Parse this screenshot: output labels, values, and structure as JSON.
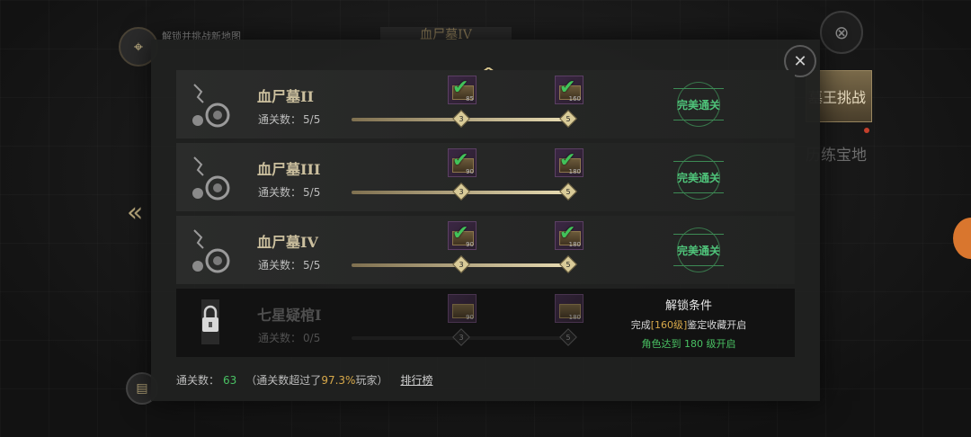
{
  "background": {
    "map_hint": "解锁并挑战新地图",
    "title_tab": "血尸墓IV",
    "challenge_label": "墓王挑战",
    "sub_label": "历练宝地"
  },
  "rows": [
    {
      "name": "血尸墓II",
      "clear_label": "通关数：",
      "clear_value": "5/5",
      "progress": 1.0,
      "nodes": [
        "3",
        "5"
      ],
      "chest1_level": "85",
      "chest2_level": "160",
      "badge": "完美通关"
    },
    {
      "name": "血尸墓III",
      "clear_label": "通关数：",
      "clear_value": "5/5",
      "progress": 1.0,
      "nodes": [
        "3",
        "5"
      ],
      "chest1_level": "90",
      "chest2_level": "180",
      "badge": "完美通关"
    },
    {
      "name": "血尸墓IV",
      "clear_label": "通关数：",
      "clear_value": "5/5",
      "progress": 1.0,
      "nodes": [
        "3",
        "5"
      ],
      "chest1_level": "90",
      "chest2_level": "180",
      "badge": "完美通关"
    }
  ],
  "locked_row": {
    "name": "七星疑棺I",
    "clear_label": "通关数：",
    "clear_value": "0/5",
    "progress": 0.0,
    "nodes": [
      "3",
      "5"
    ],
    "chest1_level": "90",
    "chest2_level": "180",
    "unlock_title": "解锁条件",
    "cond_prefix": "完成",
    "cond_highlight": "[160级]",
    "cond_suffix": "鉴定收藏开启",
    "role_cond": "角色达到 180 级开启"
  },
  "footer": {
    "count_label": "通关数：",
    "count_value": "63",
    "note_prefix": "（通关数超过了",
    "note_pct": "97.3%",
    "note_suffix": "玩家）",
    "rank_link": "排行榜"
  },
  "colors": {
    "accent_gold": "#d8c58d",
    "success_green": "#49c163",
    "highlight_orange": "#d8a94a"
  },
  "icons": {
    "close": "close-icon",
    "caret": "chevron-up-icon",
    "lock": "lock-icon"
  }
}
